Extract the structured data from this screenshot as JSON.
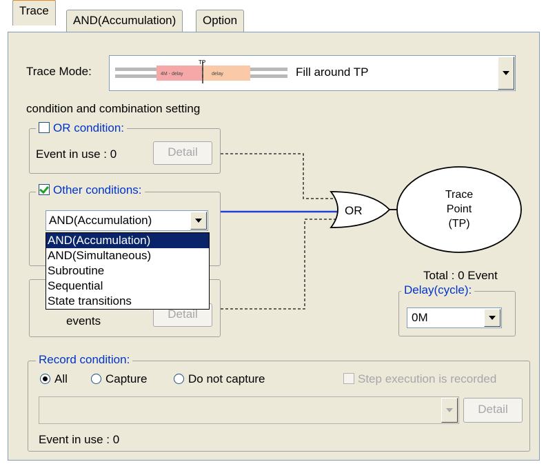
{
  "tabs": [
    {
      "label": "Trace",
      "active": true
    },
    {
      "label": "AND(Accumulation)",
      "active": false
    },
    {
      "label": "Option",
      "active": false
    }
  ],
  "trace_mode": {
    "label": "Trace Mode:",
    "value": "Fill around TP",
    "diagram": {
      "tp": "TP",
      "left": "4M - delay",
      "right": "delay"
    }
  },
  "section_title": "condition and combination setting",
  "or_condition": {
    "title": "OR condition:",
    "checked": false,
    "event_in_use": "Event in use :  0",
    "detail": "Detail"
  },
  "other_conditions": {
    "title": "Other conditions:",
    "checked": true,
    "selected": "AND(Accumulation)",
    "options": [
      "AND(Accumulation)",
      "AND(Simultaneous)",
      "Subroutine",
      "Sequential",
      "State transitions"
    ]
  },
  "hidden_group": {
    "text": "events",
    "detail": "Detail"
  },
  "logic": {
    "or_gate": "OR",
    "trace_point": [
      "Trace",
      "Point",
      "(TP)"
    ]
  },
  "total": "Total :  0  Event",
  "delay": {
    "title": "Delay(cycle):",
    "value": "0M"
  },
  "record_condition": {
    "title": "Record condition:",
    "options": [
      "All",
      "Capture",
      "Do not capture"
    ],
    "selected": "All",
    "step_execution": "Step execution is recorded",
    "detail": "Detail",
    "event_in_use": "Event in use : 0"
  },
  "colors": {
    "accent_blue": "#0033cc",
    "wire_blue": "#1f3fd8",
    "selection": "#0a246a"
  }
}
